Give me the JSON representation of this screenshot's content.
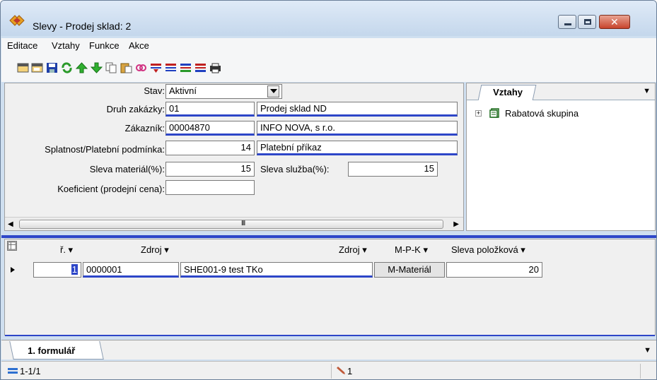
{
  "window": {
    "title": "Slevy - Prodej sklad: 2",
    "close_label": "✕"
  },
  "menu": [
    "Editace",
    "Vztahy",
    "Funkce",
    "Akce"
  ],
  "toolbar_icons": [
    "new-record-icon",
    "copy-record-icon",
    "save-icon",
    "refresh-icon",
    "move-up-icon",
    "move-down-icon",
    "copy-icon",
    "paste-icon",
    "link-icon",
    "filter-icon",
    "filter-clear-icon",
    "filter-edit-icon",
    "filter-apply-icon",
    "print-icon"
  ],
  "form": {
    "stav_label": "Stav:",
    "stav_value": "Aktivní",
    "druh_label": "Druh zakázky:",
    "druh_code": "01",
    "druh_name": "Prodej sklad ND",
    "zakaznik_label": "Zákazník:",
    "zakaznik_code": "00004870",
    "zakaznik_name": "INFO NOVA, s r.o.",
    "splatnost_label": "Splatnost/Platební podmínka:",
    "splatnost_days": "14",
    "splatnost_name": "Platební příkaz",
    "sleva_mat_label": "Sleva materiál(%):",
    "sleva_mat_value": "15",
    "sleva_sluz_label": "Sleva služba(%):",
    "sleva_sluz_value": "15",
    "koef_label": "Koeficient (prodejní cena):",
    "koef_value": "",
    "scroll_grip": "III",
    "scroll_left": "◀",
    "scroll_right": "▶"
  },
  "relations": {
    "tab": "Vztahy",
    "dropdown": "▼",
    "expand": "+",
    "tree_item": "Rabatová skupina"
  },
  "grid": {
    "columns": [
      "ř. ▾",
      "Zdroj ▾",
      "Zdroj ▾",
      "M-P-K ▾",
      "Sleva položková ▾"
    ],
    "rows": [
      {
        "r": "1",
        "zdroj_code": "0000001",
        "zdroj_name": "SHE001-9 test TKo",
        "mpk": "M-Materiál",
        "sleva": "20"
      }
    ]
  },
  "bottom": {
    "tab": "1. formulář",
    "dropdown": "▼"
  },
  "status": {
    "record": "1-1/1",
    "count": "1"
  },
  "colors": {
    "accent": "#2d46c8",
    "window_frame": "#cfdff0"
  }
}
